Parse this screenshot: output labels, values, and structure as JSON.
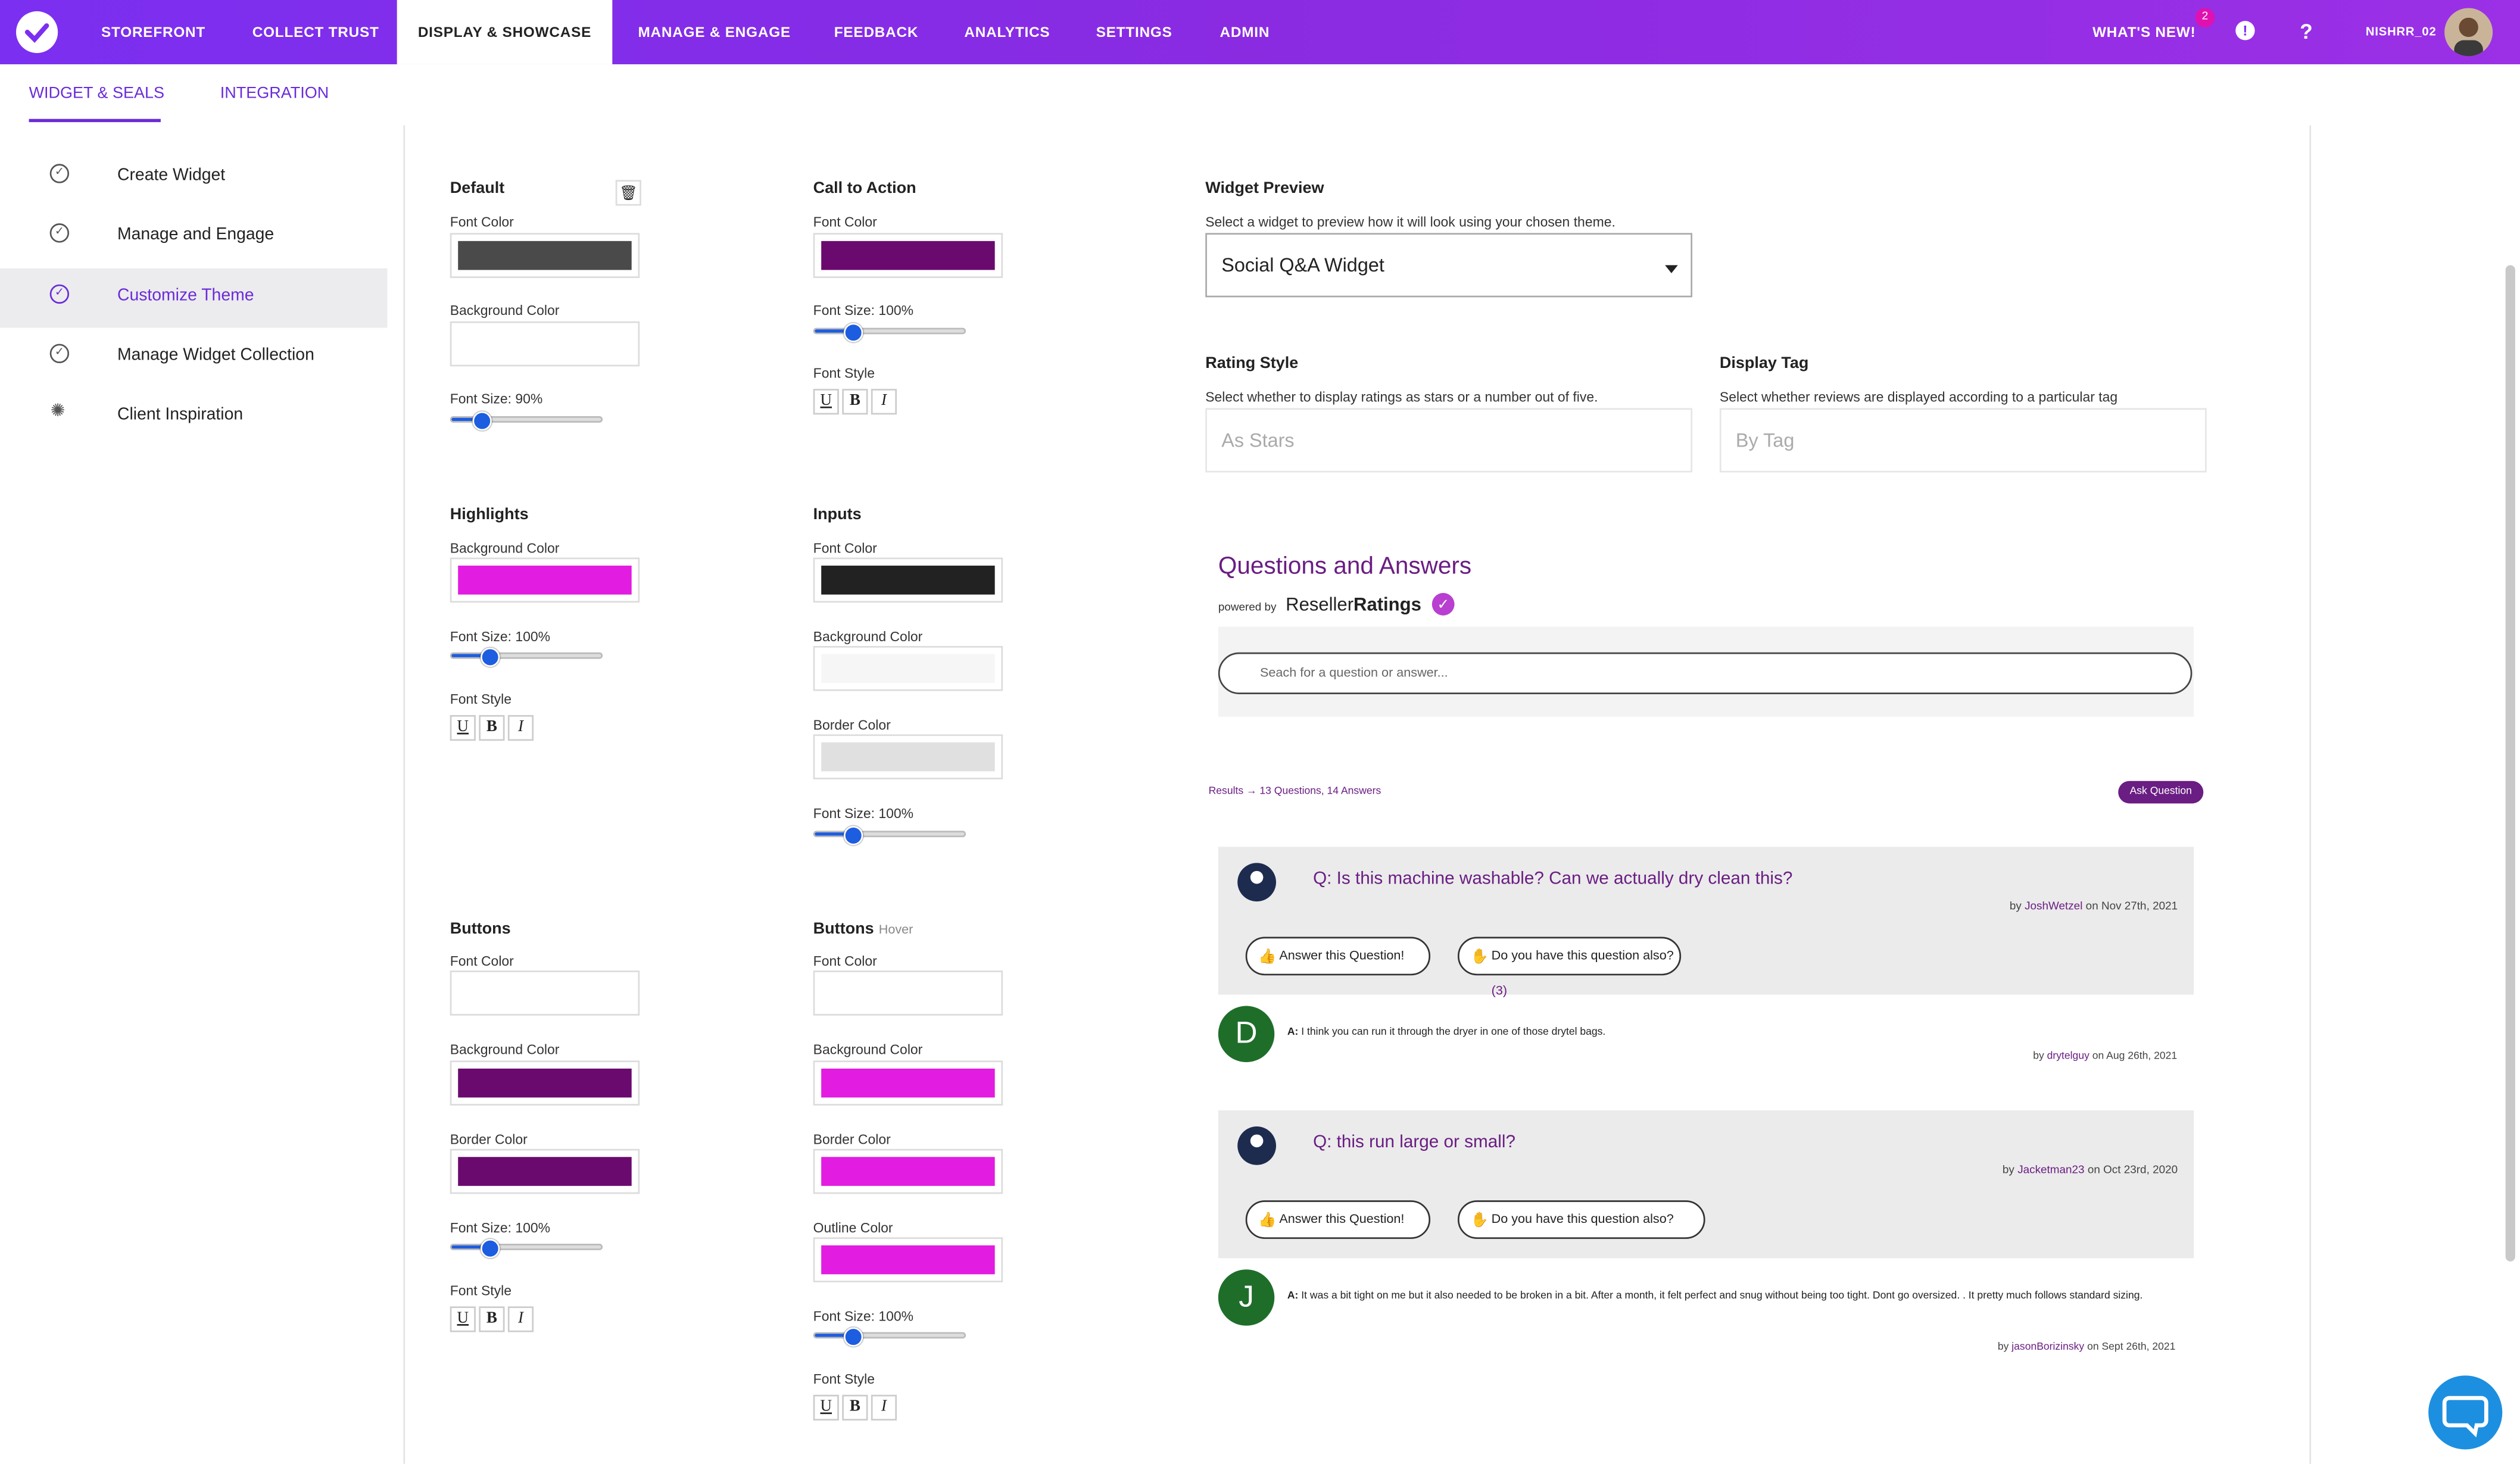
{
  "nav": {
    "items": [
      "STOREFRONT",
      "COLLECT TRUST",
      "DISPLAY & SHOWCASE",
      "MANAGE & ENGAGE",
      "FEEDBACK",
      "ANALYTICS",
      "SETTINGS",
      "ADMIN"
    ],
    "active": "DISPLAY & SHOWCASE",
    "whats_new": "WHAT'S NEW!",
    "badge_count": "2",
    "username": "NISHRR_02"
  },
  "subtabs": {
    "widget_seals": "WIDGET & SEALS",
    "integration": "INTEGRATION"
  },
  "sidebar": {
    "items": [
      {
        "label": "Create Widget",
        "icon": "check-circle-icon"
      },
      {
        "label": "Manage and Engage",
        "icon": "check-circle-icon"
      },
      {
        "label": "Customize Theme",
        "icon": "check-circle-icon"
      },
      {
        "label": "Manage Widget Collection",
        "icon": "check-circle-icon"
      },
      {
        "label": "Client Inspiration",
        "icon": "lightbulb-icon"
      }
    ],
    "active_index": 2
  },
  "theme": {
    "default": {
      "title": "Default",
      "font_color_label": "Font Color",
      "font_color": "#4a4a4a",
      "bg_label": "Background Color",
      "bg": "#ffffff",
      "font_size_label": "Font Size: 90%",
      "font_size": 90
    },
    "cta": {
      "title": "Call to Action",
      "font_color_label": "Font Color",
      "font_color": "#6a0a6e",
      "font_size_label": "Font Size: 100%",
      "font_size": 100,
      "font_style_label": "Font Style"
    },
    "highlights": {
      "title": "Highlights",
      "bg_label": "Background Color",
      "bg": "#e21ce0",
      "font_size_label": "Font Size: 100%",
      "font_size": 100,
      "font_style_label": "Font Style"
    },
    "inputs": {
      "title": "Inputs",
      "font_color_label": "Font Color",
      "font_color": "#222222",
      "bg_label": "Background Color",
      "bg": "#f6f6f6",
      "border_label": "Border Color",
      "border": "#e0e0e0",
      "font_size_label": "Font Size: 100%",
      "font_size": 100
    },
    "buttons": {
      "title": "Buttons",
      "font_color_label": "Font Color",
      "font_color": "#ffffff",
      "bg_label": "Background Color",
      "bg": "#6a0a6e",
      "border_label": "Border Color",
      "border": "#6a0a6e",
      "font_size_label": "Font Size: 100%",
      "font_size": 100,
      "font_style_label": "Font Style"
    },
    "buttons_hover": {
      "title": "Buttons",
      "hover": "Hover",
      "font_color_label": "Font Color",
      "font_color": "#ffffff",
      "bg_label": "Background Color",
      "bg": "#e21ce0",
      "border_label": "Border Color",
      "border": "#e21ce0",
      "outline_label": "Outline Color",
      "outline": "#e21ce0",
      "font_size_label": "Font Size: 100%",
      "font_size": 100,
      "font_style_label": "Font Style"
    },
    "style_buttons": [
      "U",
      "B",
      "I"
    ]
  },
  "preview": {
    "title": "Widget Preview",
    "desc": "Select a widget to preview how it will look using your chosen theme.",
    "selected_widget": "Social Q&A Widget",
    "rating_title": "Rating Style",
    "rating_desc": "Select whether to display ratings as stars or a number out of five.",
    "rating_value": "As Stars",
    "tag_title": "Display Tag",
    "tag_desc": "Select whether reviews are displayed according to a particular tag",
    "tag_value": "By Tag"
  },
  "qa": {
    "title": "Questions and Answers",
    "powered": "powered by",
    "brand_a": "Reseller",
    "brand_b": "Ratings",
    "search_placeholder": "Seach for a question or answer...",
    "results": "Results → 13 Questions, 14 Answers",
    "ask": "Ask Question",
    "questions": [
      {
        "q": "Q: Is this machine washable? Can we actually dry clean this?",
        "by": "by",
        "user": "JoshWetzel",
        "date": "on Nov 27th, 2021",
        "answer_btn": "Answer this Question!",
        "also_btn": "Do you have this question also?",
        "also_count": "(3)",
        "answer": {
          "initial": "D",
          "prefix": "A:",
          "text": "I think you can run it through the dryer in one of those drytel bags.",
          "by": "by",
          "user": "drytelguy",
          "date": "on Aug 26th, 2021"
        }
      },
      {
        "q": "Q: this run large or small?",
        "by": "by",
        "user": "Jacketman23",
        "date": "on Oct 23rd, 2020",
        "answer_btn": "Answer this Question!",
        "also_btn": "Do you have this question also?",
        "also_count": "",
        "answer": {
          "initial": "J",
          "prefix": "A:",
          "text": "It was a bit tight on me but it also needed to be broken in a bit. After a month, it felt perfect and snug without being too tight. Dont go oversized. . It pretty much follows standard sizing.",
          "by": "by",
          "user": "jasonBorizinsky",
          "date": "on Sept 26th, 2021"
        }
      }
    ]
  }
}
